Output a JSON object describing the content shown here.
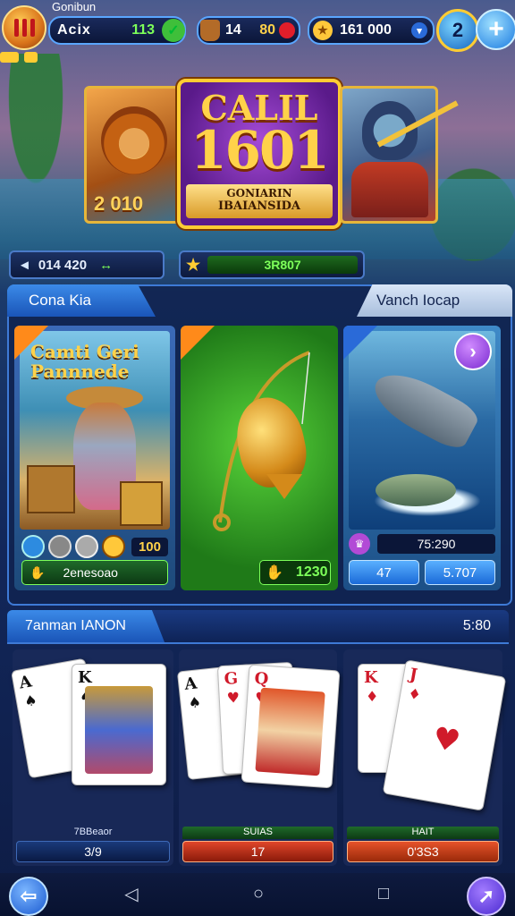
{
  "topbar": {
    "brand": "Gonibun",
    "wallet": {
      "label": "Acix",
      "value": "113"
    },
    "pot": {
      "left": "14",
      "right": "80"
    },
    "coins": {
      "value": "161 000"
    },
    "level": "2",
    "small_badges": [
      "",
      ""
    ]
  },
  "banner": {
    "left_number": "2 010",
    "title_line1": "CALIL",
    "title_line2": "1601",
    "ribbon_line1": "GONIARIN",
    "ribbon_line2": "IBAIANSIDA"
  },
  "stats": {
    "left_value": "014 420",
    "left_delta": "↔",
    "right_bar": "3R807"
  },
  "tabs": {
    "active": "Cona Kia",
    "inactive": "Vanch Iocap"
  },
  "game_cards": [
    {
      "title": "Camti Geri Pannnede",
      "count": "100",
      "footer": "2enesoao"
    },
    {
      "title": "",
      "footer": "1230"
    },
    {
      "title": "",
      "row_value": "75:290",
      "btn1": "47",
      "btn2": "5.707"
    }
  ],
  "section": {
    "label": "7anman IANON",
    "time": "5:80"
  },
  "card_slots": [
    {
      "cards": [
        "A",
        "K"
      ],
      "caption": "7BBeaor",
      "value": "3/9"
    },
    {
      "cards": [
        "A",
        "G",
        "Q"
      ],
      "caption": "SUIAS",
      "value": "17"
    },
    {
      "cards": [
        "K",
        "J"
      ],
      "caption": "HAIT",
      "value": "0'3S3"
    }
  ],
  "colors": {
    "accent_blue": "#3e7ad6",
    "gold": "#ffd24a",
    "green": "#7dff5a",
    "purple": "#7a2ad0"
  },
  "icons": [
    "menu-icon",
    "check-icon",
    "pot-icon",
    "coin-icon",
    "plus-icon",
    "star-icon",
    "chevron-right-icon",
    "back-arrow-icon",
    "forward-arrow-icon"
  ]
}
